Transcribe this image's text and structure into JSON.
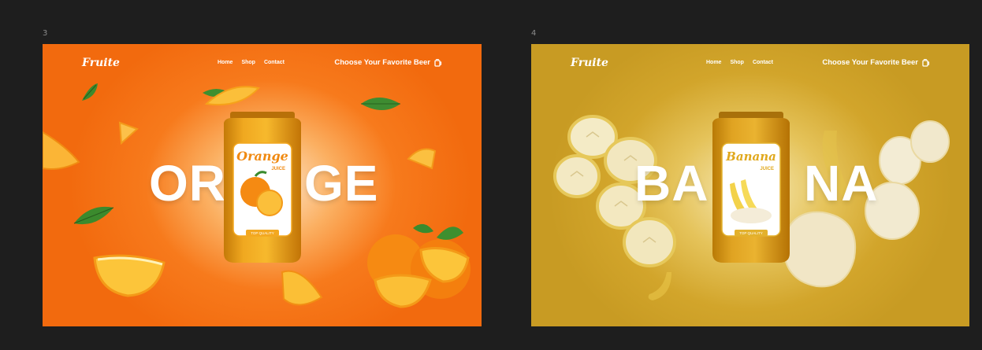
{
  "frames": [
    {
      "number": "3",
      "logo": "Fruite",
      "nav": [
        "Home",
        "Shop",
        "Contact"
      ],
      "tagline": "Choose Your Favorite Beer",
      "word_left": "OR",
      "word_right": "GE",
      "can_brand": "Orange",
      "can_sub": "JUICE",
      "can_badge": "TOP QUALITY",
      "accent": "#f26a0e",
      "icon": "mug-icon"
    },
    {
      "number": "4",
      "logo": "Fruite",
      "nav": [
        "Home",
        "Shop",
        "Contact"
      ],
      "tagline": "Choose Your Favorite Beer",
      "word_left": "BA",
      "word_right": "NA",
      "can_brand": "Banana",
      "can_sub": "JUICE",
      "can_badge": "TOP QUALITY",
      "accent": "#c89b23",
      "icon": "mug-icon"
    }
  ]
}
